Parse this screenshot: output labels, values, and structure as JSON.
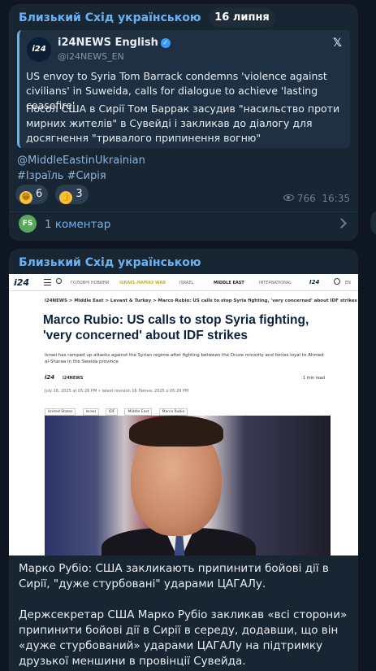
{
  "date_label": "16 липня",
  "post1": {
    "channel": "Близький Схід українською",
    "quote": {
      "avatar_text": "i24",
      "author": "i24NEWS English",
      "handle": "@i24NEWS_EN",
      "text_en": "US envoy to Syria Tom Barrack condemns 'violence against civilians' in Suweida, calls for dialogue to achieve 'lasting ceasefire'",
      "text_uk": "Посол США в Сирії Том Баррак засудив \"насильство проти мирних жителів\" в Сувейді і закликав до діалогу для досягнення \"тривалого припинення вогню\""
    },
    "link": "@MiddleEastinUkrainian",
    "hashtags": "#Ізраїль #Сирія",
    "reactions": [
      {
        "emoji_name": "grin-emoji",
        "count": "6"
      },
      {
        "emoji_name": "thumbs-up-emoji",
        "count": "3"
      }
    ],
    "views": "766",
    "time": "16:35",
    "comment_avatar": "FS",
    "comments_label": "1 коментар"
  },
  "post2": {
    "channel": "Близький Схід українською",
    "article": {
      "logo": "i24",
      "nav_items": [
        "ГОЛОВНІ НОВИНИ",
        "ISRAEL-HAMAS WAR",
        "ISRAEL",
        "MIDDLE EAST",
        "INTERNATIONAL"
      ],
      "nav_logo_right": "i24",
      "lang": "EN",
      "breadcrumb": "i24NEWS  >  Middle East  >  Levant & Turkey  >  Marco Rubio: US calls to stop Syria fighting, 'very concerned' about IDF strikes",
      "headline": "Marco Rubio: US calls to stop Syria fighting, 'very concerned' about IDF strikes",
      "subhead": "Israel has ramped up attacks against the Syrian regime after fighting between the Druze minority and forces loyal to Ahmed al-Sharaa in the Sweida province",
      "source_logo": "i24",
      "source": "i24NEWS",
      "read_time": "1 min read",
      "dateline": "July 16, 2025 at 05:26 PM  •  latest revision 16 Липня, 2025 о 05:29 PM",
      "tags": [
        "United States",
        "Israel",
        "IDF",
        "Middle East",
        "Marco Rubio"
      ]
    },
    "caption_1": "Марко Рубіо: США закликають припинити бойові дії в Сирії, \"дуже стурбовані\" ударами ЦАГАЛу.",
    "caption_2": "Держсекретар США Марко Рубіо закликав «всі сторони» припинити бойові дії в Сирії в середу, додавши, що він «дуже стурбований» ударами ЦАГАЛу на підтримку друзької меншини в провінції Сувейда."
  },
  "colors": {
    "background": "#0e1621",
    "bubble": "#182533",
    "accent": "#6ab3f3",
    "comment_avatar": "#58a85d"
  }
}
